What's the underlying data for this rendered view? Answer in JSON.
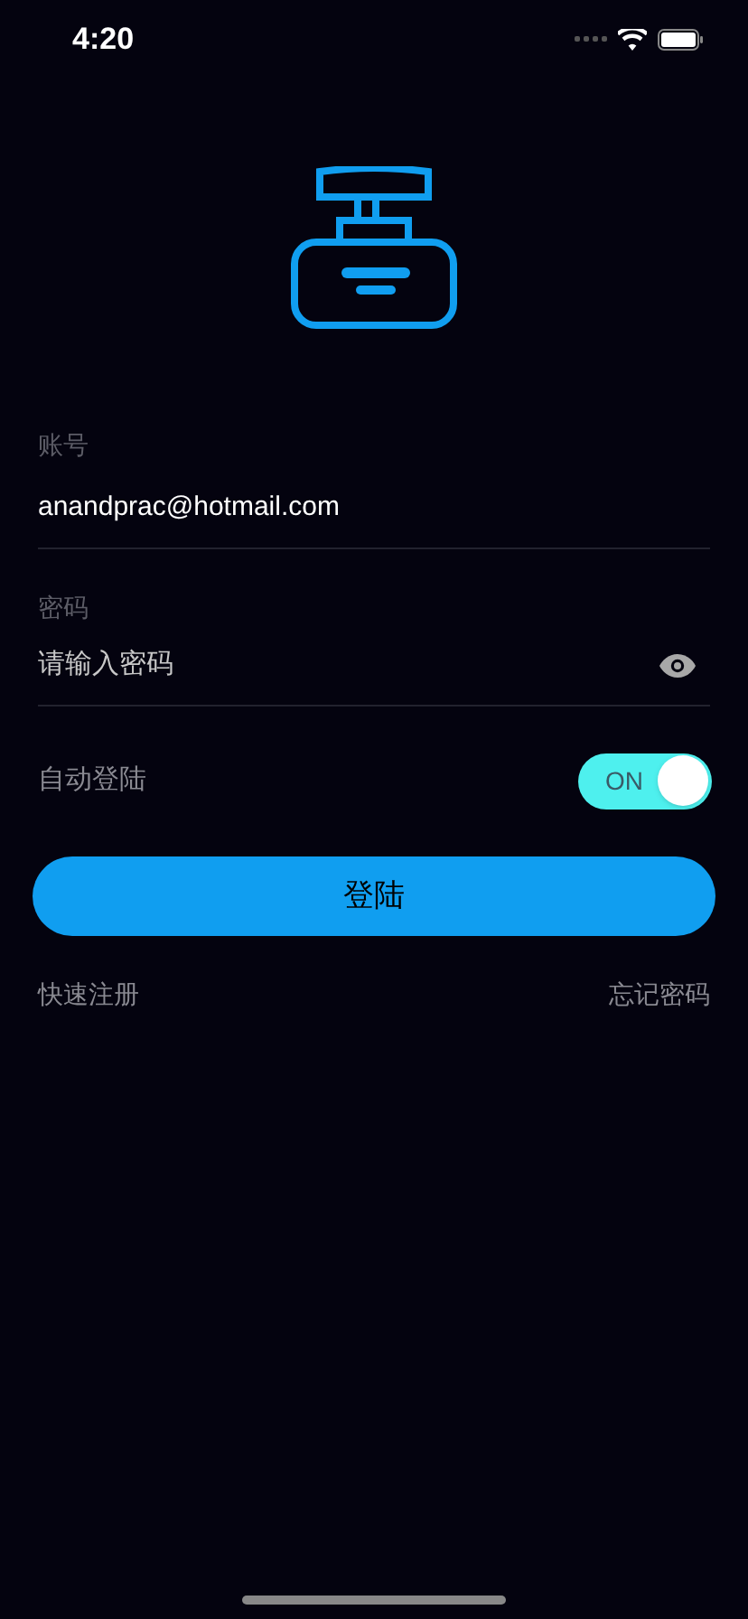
{
  "status_bar": {
    "time": "4:20"
  },
  "account": {
    "label": "账号",
    "value": "anandprac@hotmail.com"
  },
  "password": {
    "label": "密码",
    "placeholder": "请输入密码"
  },
  "auto_login": {
    "label": "自动登陆",
    "on": true,
    "switch_text": "ON"
  },
  "login_button": {
    "label": "登陆"
  },
  "links": [
    {
      "label": "快速注册"
    },
    {
      "label": "忘记密码"
    }
  ]
}
